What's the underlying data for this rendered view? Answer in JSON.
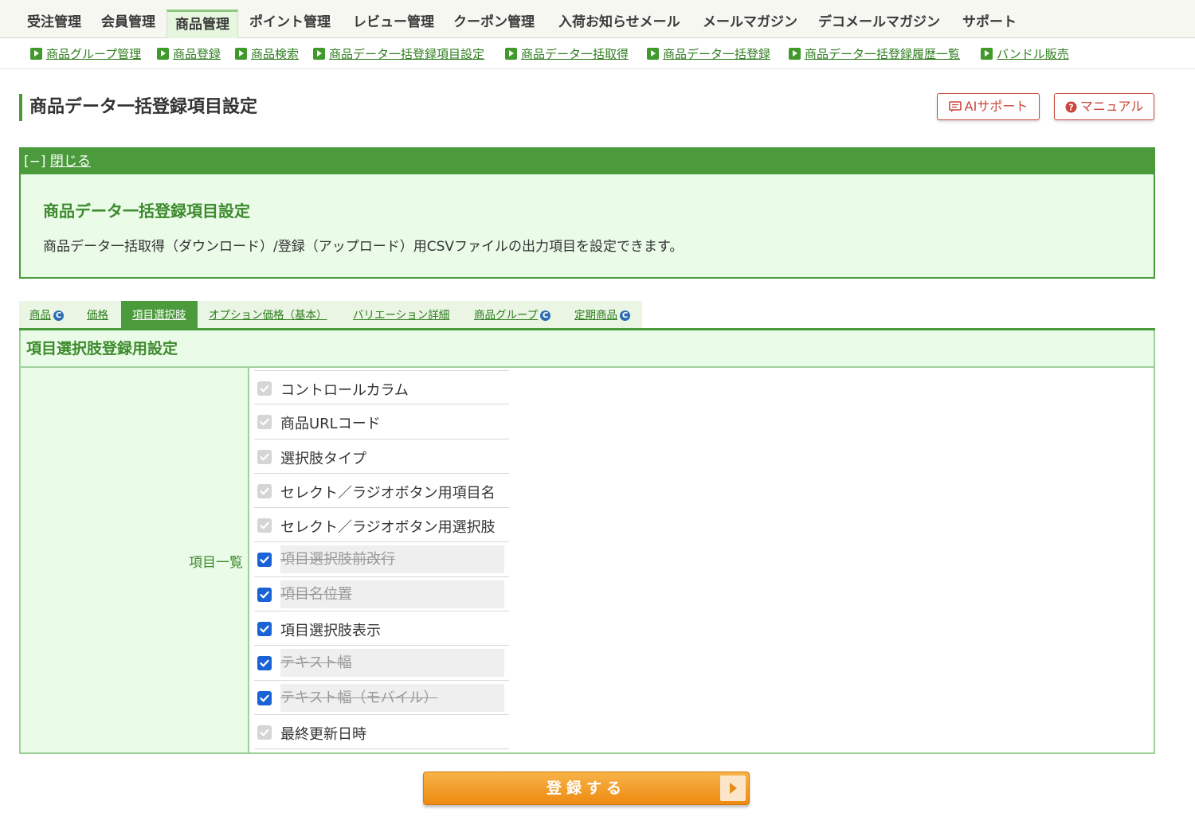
{
  "main_nav": {
    "items": [
      "受注管理",
      "会員管理",
      "商品管理",
      "ポイント管理",
      "レビュー管理",
      "クーポン管理",
      "入荷お知らせメール",
      "メールマガジン",
      "デコメールマガジン",
      "サポート"
    ],
    "active": "商品管理"
  },
  "sub_nav": {
    "items": [
      "商品グループ管理",
      "商品登録",
      "商品検索",
      "商品データ一括登録項目設定",
      "商品データ一括取得",
      "商品データ一括登録",
      "商品データ一括登録履歴一覧",
      "バンドル販売"
    ]
  },
  "page": {
    "title": "商品データ一括登録項目設定",
    "ai_button": "AIサポート",
    "manual_button": "マニュアル"
  },
  "info": {
    "toggle_prefix": "[−]",
    "close_label": "閉じる",
    "title": "商品データ一括登録項目設定",
    "description": "商品データ一括取得（ダウンロード）/登録（アップロード）用CSVファイルの出力項目を設定できます。"
  },
  "tabs": {
    "items": [
      "商品",
      "価格",
      "項目選択肢",
      "オプション価格（基本）",
      "バリエーション詳細",
      "商品グループ",
      "定期商品"
    ],
    "active": "項目選択肢",
    "c_mark": "C"
  },
  "settings": {
    "title": "項目選択肢登録用設定",
    "label": "項目一覧",
    "items": [
      {
        "label": "コントロールカラム",
        "state": "disabled"
      },
      {
        "label": "商品URLコード",
        "state": "disabled"
      },
      {
        "label": "選択肢タイプ",
        "state": "disabled"
      },
      {
        "label": "セレクト／ラジオボタン用項目名",
        "state": "disabled"
      },
      {
        "label": "セレクト／ラジオボタン用選択肢",
        "state": "disabled"
      },
      {
        "label": "項目選択肢前改行",
        "state": "checked-unavailable"
      },
      {
        "label": "項目名位置",
        "state": "checked-unavailable"
      },
      {
        "label": "項目選択肢表示",
        "state": "checked"
      },
      {
        "label": "テキスト幅",
        "state": "checked-unavailable"
      },
      {
        "label": "テキスト幅（モバイル）",
        "state": "checked-unavailable"
      },
      {
        "label": "最終更新日時",
        "state": "disabled"
      }
    ]
  },
  "submit_label": "登録する",
  "colors": {
    "brand_green": "#4b9a3c",
    "panel_green": "#eafbe8",
    "link_green": "#2f7d1f",
    "checkbox_blue": "#1a63d6",
    "submit_orange": "#ee8a12",
    "help_red": "#c9473c"
  },
  "icons": {
    "sub_nav_bullet": "arrow-right-icon",
    "ai_button": "chat-icon",
    "manual_button": "question-circle-icon",
    "checkbox": "check-icon",
    "submit": "arrow-right-icon"
  }
}
